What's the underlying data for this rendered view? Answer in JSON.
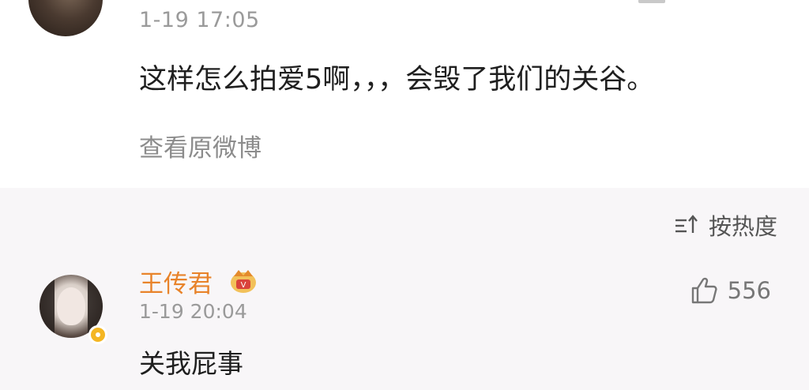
{
  "post": {
    "time": "1-19 17:05",
    "text": "这样怎么拍爱5啊，，，会毁了我们的关谷。",
    "view_original_label": "查看原微博"
  },
  "comments_header": {
    "sort_label": "按热度",
    "sort_icon": "sort-icon"
  },
  "comment": {
    "author": "王传君",
    "time": "1-19 20:04",
    "text": "关我屁事",
    "like_count": "556",
    "like_icon": "thumbs-up-icon",
    "member_badge_icon": "member-badge-icon",
    "verified_badge_color": "#f4b623"
  },
  "colors": {
    "author_name": "#e8832a",
    "secondary_text": "#9a9a9a",
    "primary_text": "#1f1f1f",
    "section_bg": "#f8f6f8"
  }
}
